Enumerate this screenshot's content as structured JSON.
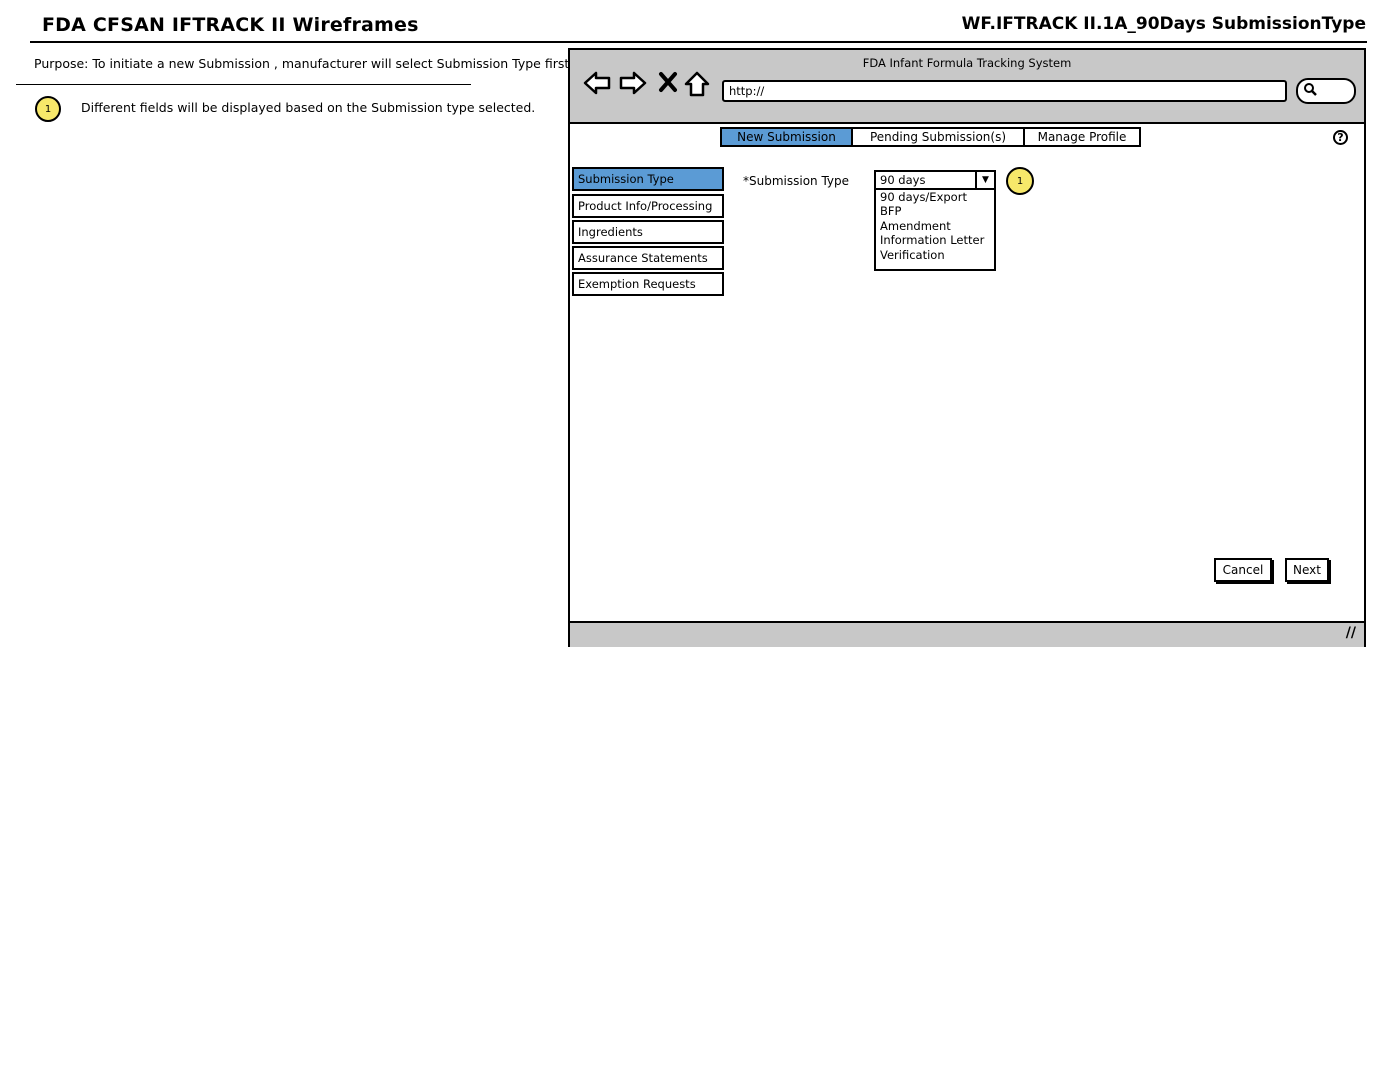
{
  "header": {
    "title": "FDA CFSAN IFTRACK II Wireframes",
    "doc_id": "WF.IFTRACK II.1A_90Days SubmissionType"
  },
  "notes": {
    "purpose": "Purpose: To initiate a new Submission , manufacturer will select Submission Type first",
    "badge": "1",
    "note_1": "Different fields will be displayed based on the Submission type selected."
  },
  "browser": {
    "window_title": "FDA Infant Formula Tracking System",
    "url": "http://",
    "icons": [
      "back-arrow-icon",
      "forward-arrow-icon",
      "close-x-icon",
      "home-icon",
      "search-icon"
    ],
    "search_glyph": "🔍"
  },
  "tabs": [
    {
      "label": "New Submission",
      "active": true
    },
    {
      "label": "Pending Submission(s)",
      "active": false
    },
    {
      "label": "Manage Profile",
      "active": false
    }
  ],
  "help_icon": "?",
  "sidebar": {
    "items": [
      {
        "label": "Submission Type",
        "active": true
      },
      {
        "label": "Product Info/Processing",
        "active": false
      },
      {
        "label": "Ingredients",
        "active": false
      },
      {
        "label": "Assurance Statements",
        "active": false
      },
      {
        "label": "Exemption Requests",
        "active": false
      }
    ]
  },
  "form": {
    "submission_type_label": "*Submission Type",
    "selected": "90 days",
    "badge": "1",
    "options": [
      "90 days/Export",
      "BFP",
      "Amendment",
      "Information Letter",
      "Verification"
    ]
  },
  "buttons": {
    "cancel": "Cancel",
    "next": "Next"
  },
  "colors": {
    "accent": "#5b9bd5",
    "badge": "#f7e86a",
    "chrome": "#c8c8c8"
  }
}
